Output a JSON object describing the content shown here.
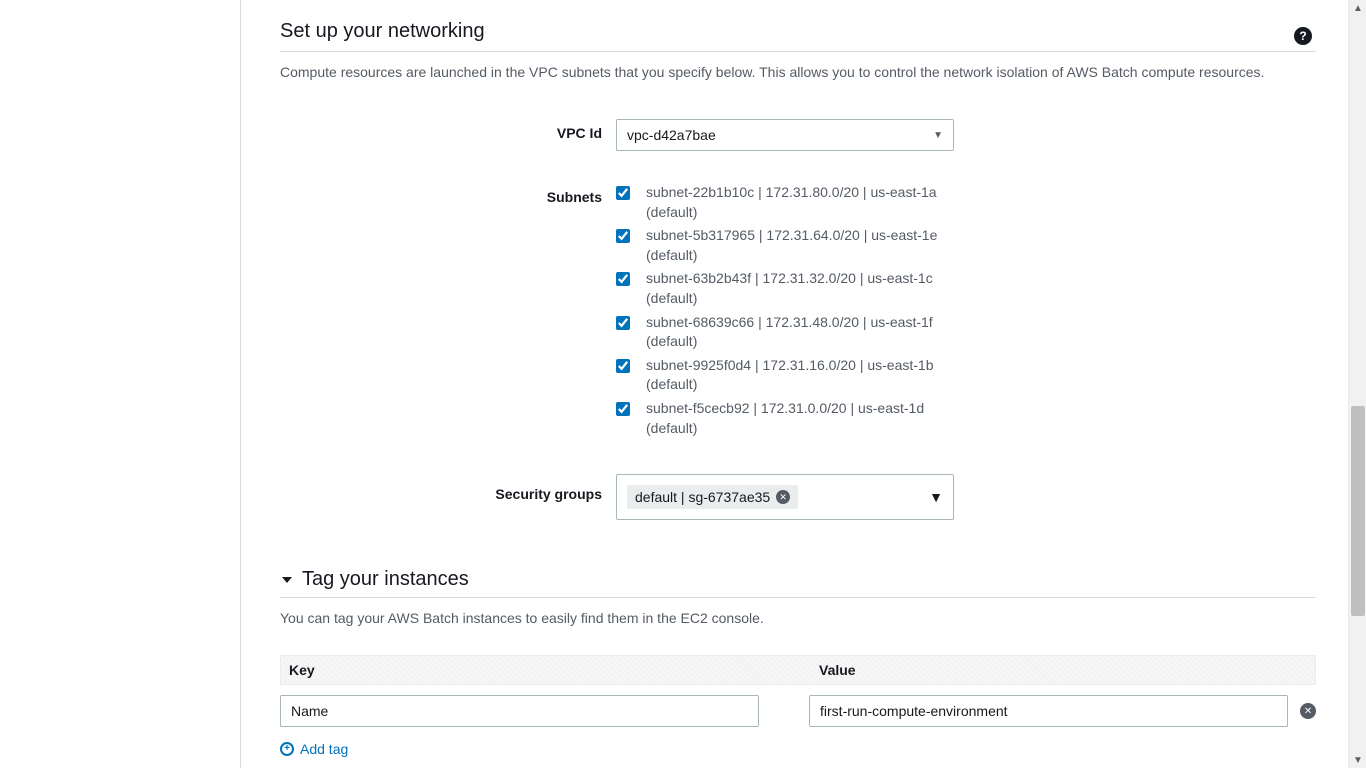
{
  "networking": {
    "title": "Set up your networking",
    "description": "Compute resources are launched in the VPC subnets that you specify below. This allows you to control the network isolation of AWS Batch compute resources.",
    "vpc": {
      "label": "VPC Id",
      "selected": "vpc-d42a7bae"
    },
    "subnets": {
      "label": "Subnets",
      "items": [
        {
          "checked": true,
          "text": "subnet-22b1b10c | 172.31.80.0/20 | us-east-1a (default)"
        },
        {
          "checked": true,
          "text": "subnet-5b317965 | 172.31.64.0/20 | us-east-1e (default)"
        },
        {
          "checked": true,
          "text": "subnet-63b2b43f | 172.31.32.0/20 | us-east-1c (default)"
        },
        {
          "checked": true,
          "text": "subnet-68639c66 | 172.31.48.0/20 | us-east-1f (default)"
        },
        {
          "checked": true,
          "text": "subnet-9925f0d4 | 172.31.16.0/20 | us-east-1b (default)"
        },
        {
          "checked": true,
          "text": "subnet-f5cecb92 | 172.31.0.0/20 | us-east-1d (default)"
        }
      ]
    },
    "security_groups": {
      "label": "Security groups",
      "chip": "default | sg-6737ae35"
    }
  },
  "tags": {
    "title": "Tag your instances",
    "description": "You can tag your AWS Batch instances to easily find them in the EC2 console.",
    "header_key": "Key",
    "header_value": "Value",
    "rows": [
      {
        "key": "Name",
        "value": "first-run-compute-environment"
      }
    ],
    "add_label": "Add tag"
  }
}
